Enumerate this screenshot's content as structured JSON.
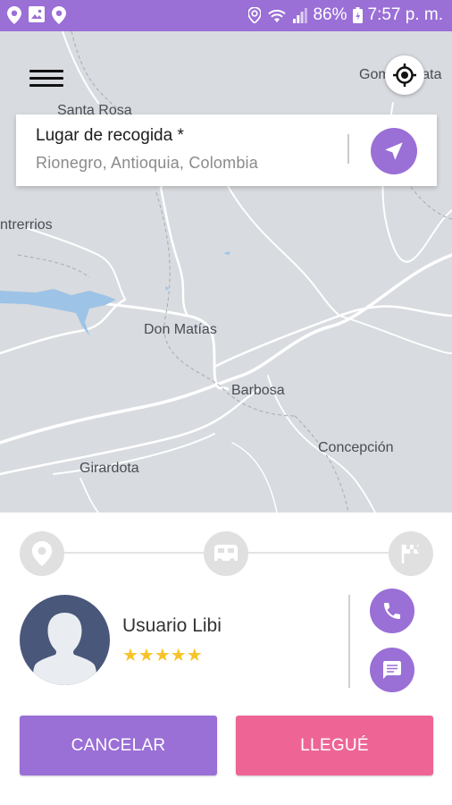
{
  "status_bar": {
    "battery": "86%",
    "time": "7:57 p. m.",
    "left_icons": [
      "location-pin-icon",
      "image-icon",
      "location-pin-icon"
    ],
    "right_icons": [
      "location-icon",
      "wifi-icon",
      "signal-icon",
      "battery-icon"
    ]
  },
  "map": {
    "labels": {
      "santa_rosa": "Santa Rosa",
      "gomez_plata": "Gomez Plata",
      "entrerrios": "ntrerrios",
      "don_matias": "Don Matías",
      "barbosa": "Barbosa",
      "concepcion": "Concepción",
      "girardota": "Girardota"
    }
  },
  "pickup": {
    "title": "Lugar de recogida *",
    "address": "Rionegro, Antioquia, Colombia"
  },
  "progress": {
    "steps": [
      "pin-icon",
      "car-icon",
      "finish-flag-icon"
    ]
  },
  "driver": {
    "name": "Usuario Libi",
    "rating": 5,
    "stars": "★★★★★"
  },
  "actions": {
    "cancel": "CANCELAR",
    "arrived": "LLEGUÉ"
  },
  "colors": {
    "accent": "#9a6fd6",
    "pink": "#ee6595",
    "map_bg": "#d8dbdf",
    "star": "#f7c32a"
  }
}
